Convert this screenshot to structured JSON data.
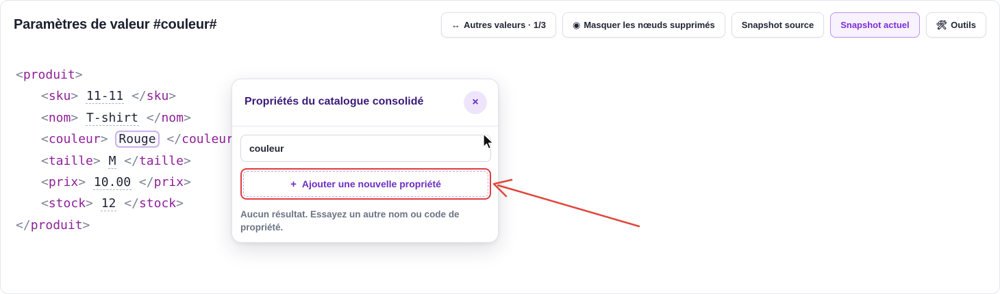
{
  "header": {
    "title": "Paramètres de valeur #couleur#"
  },
  "toolbar": {
    "other_values": {
      "icon": "↔",
      "label": "Autres valeurs · 1/3"
    },
    "hide_deleted": {
      "icon": "◉",
      "label": "Masquer les nœuds supprimés"
    },
    "snapshot_source": {
      "label": "Snapshot source"
    },
    "snapshot_current": {
      "label": "Snapshot actuel",
      "active": true
    },
    "tools": {
      "icon": "🛠",
      "label": "Outils"
    }
  },
  "xml": {
    "root_open": "produit",
    "root_close": "produit",
    "fields": [
      {
        "tag": "sku",
        "value": "11-11"
      },
      {
        "tag": "nom",
        "value": "T-shirt"
      },
      {
        "tag": "couleur",
        "value": "Rouge",
        "selected": true
      },
      {
        "tag": "taille",
        "value": "M"
      },
      {
        "tag": "prix",
        "value": "10.00"
      },
      {
        "tag": "stock",
        "value": "12"
      }
    ]
  },
  "popover": {
    "title": "Propriétés du catalogue consolidé",
    "close_icon": "×",
    "search_value": "couleur",
    "add_button": {
      "icon": "+",
      "label": "Ajouter une nouvelle propriété"
    },
    "empty_message": "Aucun résultat. Essayez un autre nom ou code de propriété."
  },
  "colors": {
    "accent": "#7c2fd6",
    "tag": "#8f1f9a",
    "highlight_border": "#e03a3a",
    "annotation_arrow": "#e0463a"
  }
}
